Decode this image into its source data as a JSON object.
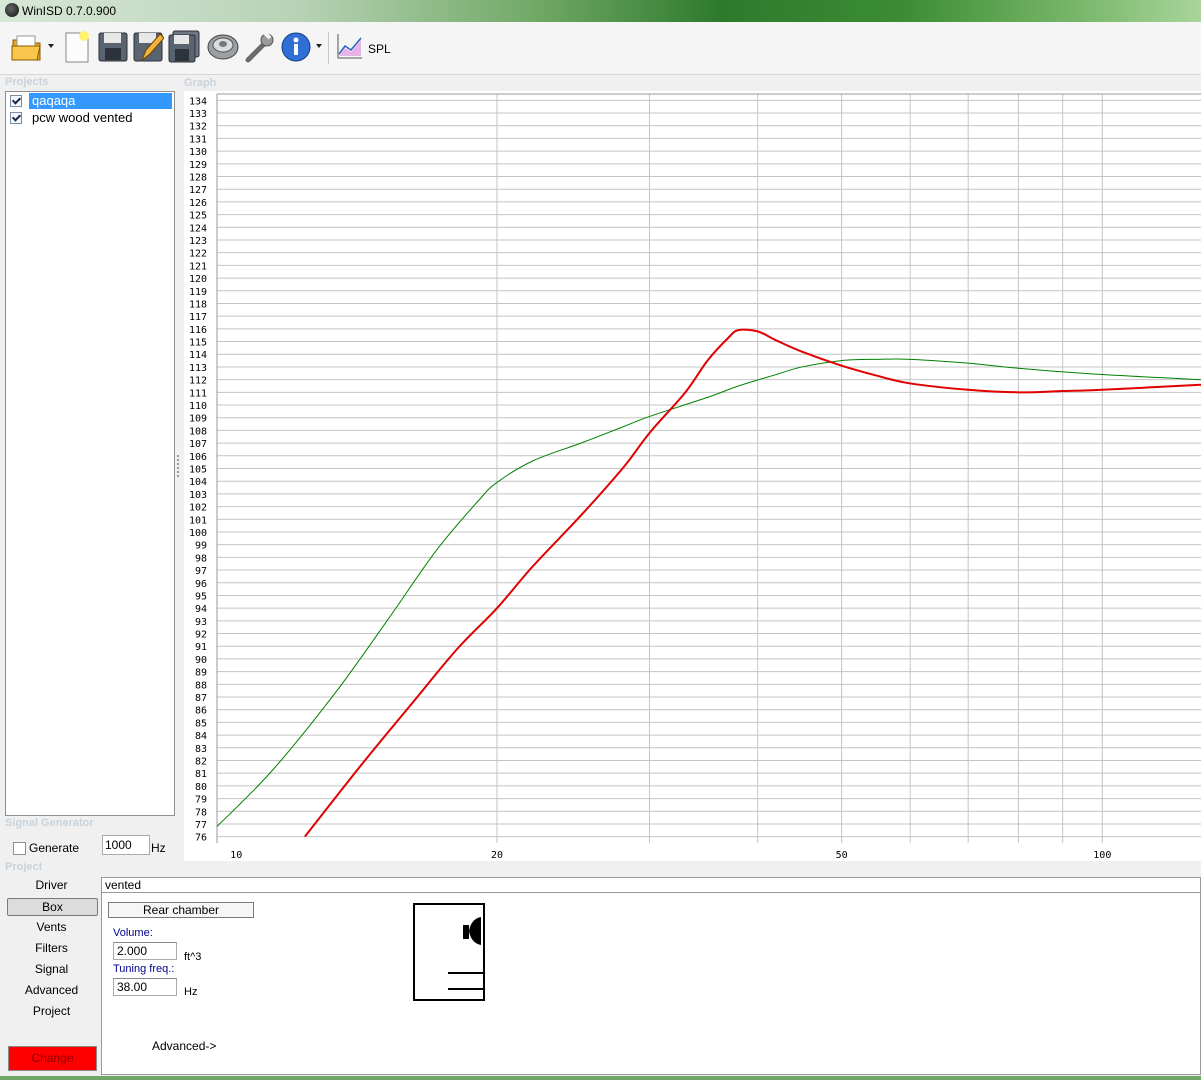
{
  "window": {
    "title": "WinISD 0.7.0.900"
  },
  "toolbar": {
    "buttons": [
      "open-folder-icon",
      "new-document-icon",
      "save-icon",
      "save-as-icon",
      "save-all-icon",
      "driver-speaker-icon",
      "settings-wrench-icon",
      "info-icon",
      "spl-graph-icon"
    ],
    "graph_label": "SPL"
  },
  "projects": {
    "caption": "Projects",
    "items": [
      {
        "label": "qaqaqa",
        "checked": true,
        "selected": true
      },
      {
        "label": "pcw wood vented",
        "checked": true,
        "selected": false
      }
    ]
  },
  "graph": {
    "caption": "Graph"
  },
  "signal_generator": {
    "caption": "Signal Generator",
    "generate_label": "Generate",
    "generate_checked": false,
    "frequency": "1000",
    "unit": "Hz"
  },
  "project": {
    "caption": "Project",
    "nav": [
      "Driver",
      "Box",
      "Vents",
      "Filters",
      "Signal",
      "Advanced",
      "Project"
    ],
    "active": "Box",
    "change_label": "Change"
  },
  "box": {
    "name": "vented",
    "rear_chamber_label": "Rear chamber",
    "volume_label": "Volume:",
    "volume": "2.000",
    "volume_unit": "ft^3",
    "tuning_label": "Tuning freq.:",
    "tuning": "38.00",
    "tuning_unit": "Hz",
    "advanced_label": "Advanced->"
  },
  "chart_data": {
    "type": "line",
    "x_scale": "log",
    "xlim": [
      9.5,
      130
    ],
    "ylim": [
      75.5,
      134.5
    ],
    "y_ticks": [
      76,
      77,
      78,
      79,
      80,
      81,
      82,
      83,
      84,
      85,
      86,
      87,
      88,
      89,
      90,
      91,
      92,
      93,
      94,
      95,
      96,
      97,
      98,
      99,
      100,
      101,
      102,
      103,
      104,
      105,
      106,
      107,
      108,
      109,
      110,
      111,
      112,
      113,
      114,
      115,
      116,
      117,
      118,
      119,
      120,
      121,
      122,
      123,
      124,
      125,
      126,
      127,
      128,
      129,
      130,
      131,
      132,
      133,
      134
    ],
    "x_tick_labels": [
      10,
      20,
      50,
      100
    ],
    "x_gridlines": [
      20,
      30,
      40,
      50,
      60,
      70,
      80,
      90,
      100
    ],
    "grid": true,
    "series": [
      {
        "color": "#008000",
        "width": 1,
        "x": [
          9.5,
          11,
          13,
          15,
          17,
          19,
          20,
          22,
          25,
          28,
          30,
          35,
          38,
          42,
          45,
          50,
          55,
          60,
          70,
          80,
          100,
          130
        ],
        "y": [
          76.8,
          81.2,
          87.3,
          93.2,
          98.5,
          102.4,
          103.9,
          105.6,
          107.0,
          108.3,
          109.1,
          110.6,
          111.5,
          112.4,
          113.0,
          113.5,
          113.6,
          113.6,
          113.3,
          112.9,
          112.4,
          112.0
        ]
      },
      {
        "color": "#e00000",
        "width": 2,
        "x": [
          12,
          14,
          16,
          18,
          20,
          22,
          25,
          28,
          30,
          33,
          35,
          37,
          38,
          40,
          42,
          45,
          50,
          55,
          60,
          70,
          80,
          90,
          100,
          130
        ],
        "y": [
          76.0,
          81.8,
          86.6,
          90.8,
          94.0,
          97.3,
          101.3,
          105.1,
          107.8,
          111.0,
          113.5,
          115.3,
          115.9,
          115.8,
          115.1,
          114.2,
          113.1,
          112.3,
          111.7,
          111.2,
          111.0,
          111.1,
          111.2,
          111.6
        ]
      }
    ]
  }
}
